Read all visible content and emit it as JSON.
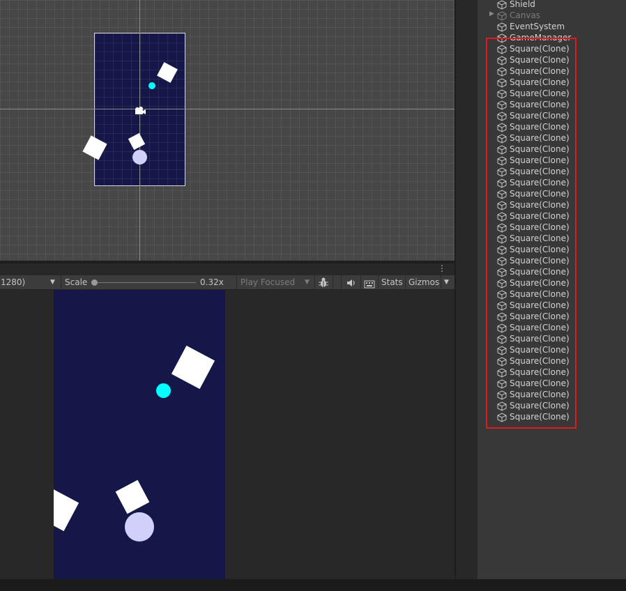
{
  "toolbar": {
    "resolution_label": "1280)",
    "scale_label": "Scale",
    "scale_value": "0.32x",
    "scale_fraction": 0.0,
    "play_mode": "Play Focused",
    "stats_label": "Stats",
    "gizmos_label": "Gizmos"
  },
  "hierarchy": {
    "items": [
      {
        "label": "Shield",
        "dim": false,
        "expandable": false
      },
      {
        "label": "Canvas",
        "dim": true,
        "expandable": true
      },
      {
        "label": "EventSystem",
        "dim": false,
        "expandable": false
      },
      {
        "label": "GameManager",
        "dim": false,
        "expandable": false
      },
      {
        "label": "Square(Clone)",
        "dim": false,
        "expandable": false
      },
      {
        "label": "Square(Clone)",
        "dim": false,
        "expandable": false
      },
      {
        "label": "Square(Clone)",
        "dim": false,
        "expandable": false
      },
      {
        "label": "Square(Clone)",
        "dim": false,
        "expandable": false
      },
      {
        "label": "Square(Clone)",
        "dim": false,
        "expandable": false
      },
      {
        "label": "Square(Clone)",
        "dim": false,
        "expandable": false
      },
      {
        "label": "Square(Clone)",
        "dim": false,
        "expandable": false
      },
      {
        "label": "Square(Clone)",
        "dim": false,
        "expandable": false
      },
      {
        "label": "Square(Clone)",
        "dim": false,
        "expandable": false
      },
      {
        "label": "Square(Clone)",
        "dim": false,
        "expandable": false
      },
      {
        "label": "Square(Clone)",
        "dim": false,
        "expandable": false
      },
      {
        "label": "Square(Clone)",
        "dim": false,
        "expandable": false
      },
      {
        "label": "Square(Clone)",
        "dim": false,
        "expandable": false
      },
      {
        "label": "Square(Clone)",
        "dim": false,
        "expandable": false
      },
      {
        "label": "Square(Clone)",
        "dim": false,
        "expandable": false
      },
      {
        "label": "Square(Clone)",
        "dim": false,
        "expandable": false
      },
      {
        "label": "Square(Clone)",
        "dim": false,
        "expandable": false
      },
      {
        "label": "Square(Clone)",
        "dim": false,
        "expandable": false
      },
      {
        "label": "Square(Clone)",
        "dim": false,
        "expandable": false
      },
      {
        "label": "Square(Clone)",
        "dim": false,
        "expandable": false
      },
      {
        "label": "Square(Clone)",
        "dim": false,
        "expandable": false
      },
      {
        "label": "Square(Clone)",
        "dim": false,
        "expandable": false
      },
      {
        "label": "Square(Clone)",
        "dim": false,
        "expandable": false
      },
      {
        "label": "Square(Clone)",
        "dim": false,
        "expandable": false
      },
      {
        "label": "Square(Clone)",
        "dim": false,
        "expandable": false
      },
      {
        "label": "Square(Clone)",
        "dim": false,
        "expandable": false
      },
      {
        "label": "Square(Clone)",
        "dim": false,
        "expandable": false
      },
      {
        "label": "Square(Clone)",
        "dim": false,
        "expandable": false
      },
      {
        "label": "Square(Clone)",
        "dim": false,
        "expandable": false
      },
      {
        "label": "Square(Clone)",
        "dim": false,
        "expandable": false
      },
      {
        "label": "Square(Clone)",
        "dim": false,
        "expandable": false
      },
      {
        "label": "Square(Clone)",
        "dim": false,
        "expandable": false
      },
      {
        "label": "Square(Clone)",
        "dim": false,
        "expandable": false
      },
      {
        "label": "Square(Clone)",
        "dim": false,
        "expandable": false
      }
    ]
  },
  "colors": {
    "highlight": "#e11b1b",
    "game_background": "#141747",
    "player": "#d0d0fa",
    "pickup": "#00ffff"
  }
}
